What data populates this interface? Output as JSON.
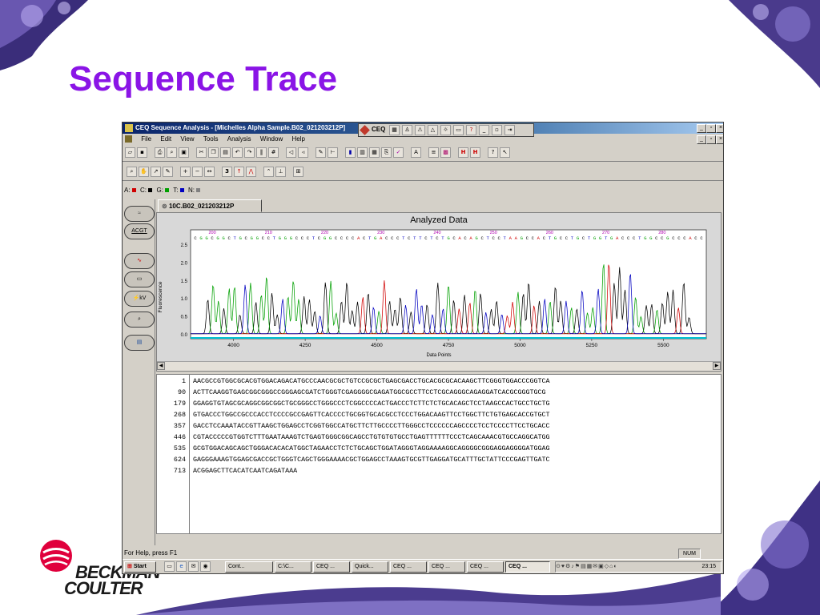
{
  "slide": {
    "title": "Sequence Trace",
    "logo_line1": "BECKMAN",
    "logo_line2": "COULTER"
  },
  "window": {
    "title": "CEQ Sequence Analysis - [Michelles Alpha Sample.B02_021203212P]",
    "menu": [
      "File",
      "Edit",
      "View",
      "Tools",
      "Analysis",
      "Window",
      "Help"
    ],
    "float_toolbar_label": "CEQ",
    "view_number": "3",
    "base_legend": [
      {
        "label": "A:",
        "color": "#d00000"
      },
      {
        "label": "C:",
        "color": "#000000"
      },
      {
        "label": "G:",
        "color": "#00a000"
      },
      {
        "label": "T:",
        "color": "#0000c0"
      },
      {
        "label": "N:",
        "color": "#808080"
      }
    ],
    "side_buttons": [
      "ACGT",
      "kV"
    ],
    "tab_label": "10C.B02_021203212P",
    "status_text": "For Help, press F1",
    "status_num": "NUM"
  },
  "chart_data": {
    "type": "line",
    "title": "Analyzed Data",
    "xlabel": "Data Points",
    "ylabel": "Fluorescence",
    "xlim": [
      3850,
      5650
    ],
    "ylim": [
      0,
      2.5
    ],
    "x_ticks": [
      "4000",
      "4250",
      "4500",
      "4750",
      "5000",
      "5250",
      "5500"
    ],
    "y_ticks": [
      "0.0",
      "0.5",
      "1.0",
      "1.5",
      "2.0",
      "2.5"
    ],
    "base_position_labels": [
      "200",
      "210",
      "220",
      "230",
      "240",
      "250",
      "260",
      "270",
      "280"
    ],
    "base_call_sequence": "CGGCGGCTGCGGCCTGGGCCCTCGGCCCCACTGACCCTCTTCTCTGCACAGCTCCTAAGCCACTGCCTGCTGGTGACCCTGGCCGCCCACC",
    "series": [
      {
        "color": "#000000",
        "values": []
      },
      {
        "color": "#00a000",
        "values": []
      },
      {
        "color": "#d00000",
        "values": []
      },
      {
        "color": "#0000c0",
        "values": []
      }
    ]
  },
  "sequence": {
    "rows": [
      {
        "num": "1",
        "text": "AACGCCGTGGCGCACGTGGACAGACATGCCCAACGCGCTGTCCGCGCTGAGCGACCTGCACGCGCACAAGCTTCGGGTGGACCCGGTCA"
      },
      {
        "num": "90",
        "text": "ACTTCAAGGTGAGCGGCGGGCCGGGAGCGATCTGGGTCGAGGGGCGAGATGGCGCCTTCCTCGCAGGGCAGAGGATCACGCGGGTGCG"
      },
      {
        "num": "179",
        "text": "GGAGGTGTAGCGCAGGCGGCGGCTGCGGGCCTGGGCCCTCGGCCCCACTGACCCTCTTCTCTGCACAGCTCCTAAGCCACTGCCTGCTG"
      },
      {
        "num": "268",
        "text": "GTGACCCTGGCCGCCCACCTCCCCGCCGAGTTCACCCCTGCGGTGCACGCCTCCCTGGACAAGTTCCTGGCTTCTGTGAGCACCGTGCT"
      },
      {
        "num": "357",
        "text": "GACCTCCAAATACCGTTAAGCTGGAGCCTCGGTGGCCATGCTTCTTGCCCCTTGGGCCTCCCCCCAGCCCCTCCTCCCCTTCCTGCACC"
      },
      {
        "num": "446",
        "text": "CGTACCCCCGTGGTCTTTGAATAAAGTCTGAGTGGGCGGCAGCCTGTGTGTGCCTGAGTTTTTTCCCTCAGCAAACGTGCCAGGCATGG"
      },
      {
        "num": "535",
        "text": "GCGTGGACAGCAGCTGGGACACACATGGCTAGAACCTCTCTGCAGCTGGATAGGGTAGGAAAAGGCAGGGGCGGGAGGAGGGGATGGAG"
      },
      {
        "num": "624",
        "text": "GAGGGAAAGTGGAGCGACCGCTGGGTCAGCTGGGAAAACGCTGGAGCCTAAAGTGCGTTGAGGATGCATTTGCTATTCCCGAGTTGATC"
      },
      {
        "num": "713",
        "text": "ACGGAGCTTCACATCAATCAGATAAA"
      }
    ]
  },
  "taskbar": {
    "start_label": "Start",
    "tasks": [
      "Cont...",
      "C:\\C...",
      "CEQ ...",
      "Quick...",
      "CEQ ...",
      "CEQ ...",
      "CEQ ...",
      "CEQ ..."
    ],
    "clock": "23:15"
  }
}
